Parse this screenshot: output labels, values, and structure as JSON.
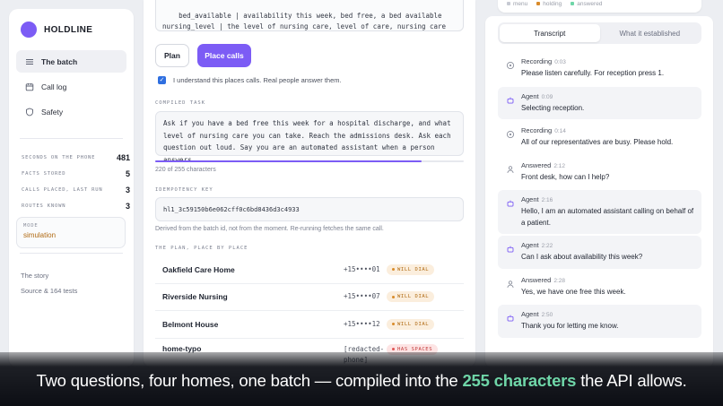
{
  "brand": {
    "name": "HOLDLINE",
    "color": "#7c5cf5"
  },
  "nav": [
    {
      "label": "The batch",
      "icon": "list-icon",
      "active": true
    },
    {
      "label": "Call log",
      "icon": "calendar-icon",
      "active": false
    },
    {
      "label": "Safety",
      "icon": "shield-icon",
      "active": false
    }
  ],
  "stats": [
    {
      "label": "SECONDS ON THE PHONE",
      "value": "481"
    },
    {
      "label": "FACTS STORED",
      "value": "5"
    },
    {
      "label": "CALLS PLACED, LAST RUN",
      "value": "3"
    },
    {
      "label": "ROUTES KNOWN",
      "value": "3"
    }
  ],
  "mode": {
    "label": "MODE",
    "value": "simulation"
  },
  "side_links": [
    "The story",
    "Source & 164 tests"
  ],
  "schema_text": "bed_available | availability this week, bed free, a bed available\nnursing_level | the level of nursing care, level of care, nursing care",
  "buttons": {
    "plan": "Plan",
    "place_calls": "Place calls"
  },
  "confirm_text": "I understand this places calls. Real people answer them.",
  "compiled_task": {
    "label": "COMPILED TASK",
    "text": "Ask if you have a bed free this week for a hospital discharge, and what level of nursing care you can take. Reach the admissions desk. Ask each question out loud. Say you are an automated assistant when a person answers.",
    "char_count": "220 of 255 characters",
    "used": 220,
    "limit": 255
  },
  "idempotency": {
    "label": "IDEMPOTENCY KEY",
    "key": "hl1_3c59150b6e062cff0c6bd8436d3c4933",
    "note": "Derived from the batch id, not from the moment. Re-running fetches the same call."
  },
  "plan": {
    "label": "THE PLAN, PLACE BY PLACE",
    "rows": [
      {
        "name": "Oakfield Care Home",
        "phone": "+15••••01",
        "status": "WILL DIAL",
        "kind": "dial"
      },
      {
        "name": "Riverside Nursing",
        "phone": "+15••••07",
        "status": "WILL DIAL",
        "kind": "dial"
      },
      {
        "name": "Belmont House",
        "phone": "+15••••12",
        "status": "WILL DIAL",
        "kind": "dial"
      },
      {
        "name": "home-typo",
        "phone": "[redacted-phone]",
        "status": "HAS SPACES",
        "kind": "warn"
      }
    ]
  },
  "legend": [
    {
      "label": "menu",
      "color": "#c7cad3"
    },
    {
      "label": "holding",
      "color": "#d98b2a"
    },
    {
      "label": "answered",
      "color": "#6fd6a8"
    }
  ],
  "tabs": [
    "Transcript",
    "What it established"
  ],
  "transcript": [
    {
      "speaker": "Recording",
      "time": "0:03",
      "text": "Please listen carefully. For reception press 1.",
      "kind": "recording"
    },
    {
      "speaker": "Agent",
      "time": "0:09",
      "text": "Selecting reception.",
      "kind": "agent"
    },
    {
      "speaker": "Recording",
      "time": "0:14",
      "text": "All of our representatives are busy. Please hold.",
      "kind": "recording"
    },
    {
      "speaker": "Answered",
      "time": "2:12",
      "text": "Front desk, how can I help?",
      "kind": "answered"
    },
    {
      "speaker": "Agent",
      "time": "2:16",
      "text": "Hello, I am an automated assistant calling on behalf of a patient.",
      "kind": "agent"
    },
    {
      "speaker": "Agent",
      "time": "2:22",
      "text": "Can I ask about availability this week?",
      "kind": "agent"
    },
    {
      "speaker": "Answered",
      "time": "2:28",
      "text": "Yes, we have one free this week.",
      "kind": "answered"
    },
    {
      "speaker": "Agent",
      "time": "2:50",
      "text": "Thank you for letting me know.",
      "kind": "agent"
    }
  ],
  "caption": {
    "before": "Two questions, four homes, one batch — compiled into the ",
    "highlight": "255 characters",
    "after": " the API allows."
  }
}
